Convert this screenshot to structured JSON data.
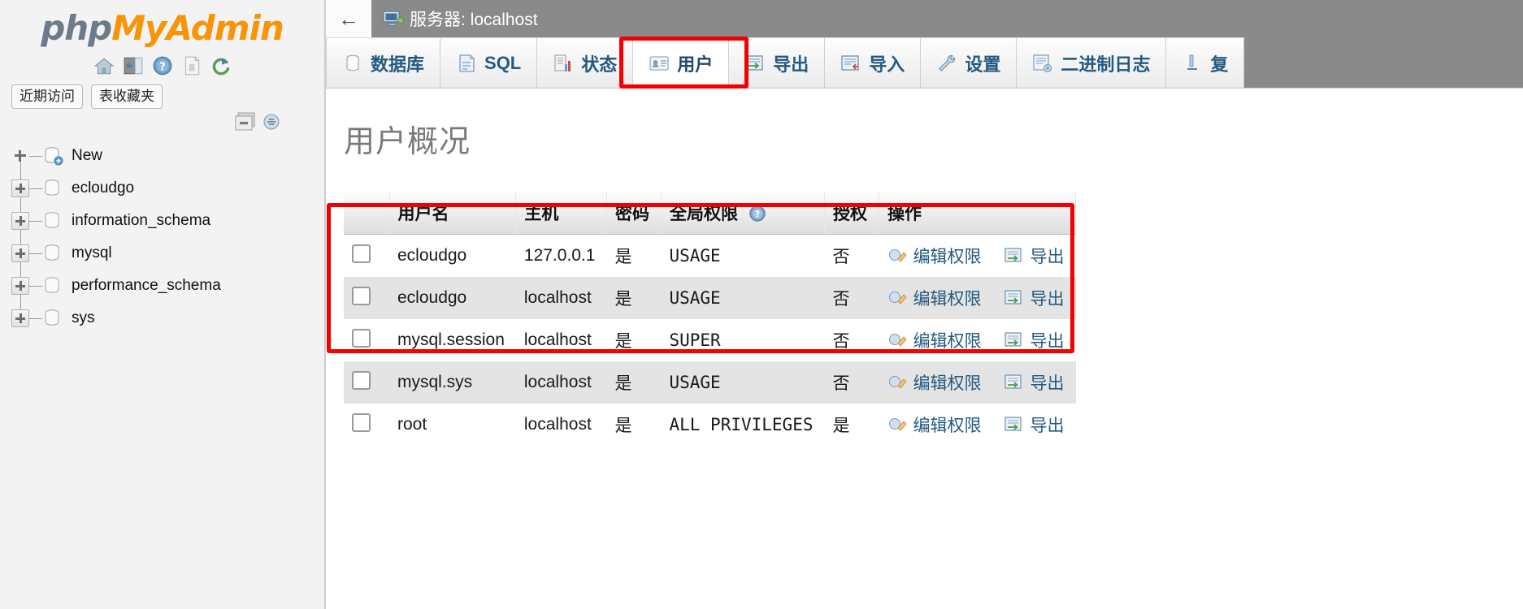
{
  "sidebar": {
    "logo": {
      "php": "php",
      "my": "My",
      "admin": "Admin"
    },
    "logo_icons": [
      {
        "name": "home-icon",
        "label": "主页"
      },
      {
        "name": "logout-icon",
        "label": "退出"
      },
      {
        "name": "help-icon",
        "label": "帮助"
      },
      {
        "name": "docs-icon",
        "label": "文档"
      },
      {
        "name": "reload-icon",
        "label": "重新加载"
      }
    ],
    "quick_buttons": [
      {
        "label": "近期访问"
      },
      {
        "label": "表收藏夹"
      }
    ],
    "panel_controls": [
      {
        "name": "collapse-icon"
      },
      {
        "name": "link-icon"
      }
    ],
    "tree": [
      {
        "label": "New",
        "expandable": false
      },
      {
        "label": "ecloudgo",
        "expandable": true
      },
      {
        "label": "information_schema",
        "expandable": true
      },
      {
        "label": "mysql",
        "expandable": true
      },
      {
        "label": "performance_schema",
        "expandable": true
      },
      {
        "label": "sys",
        "expandable": true
      }
    ]
  },
  "header": {
    "back_label": "←",
    "server_prefix": "服务器: ",
    "server_name": "localhost",
    "server_icon": "server-icon"
  },
  "tabs": [
    {
      "label": "数据库",
      "icon": "database-icon",
      "active": false
    },
    {
      "label": "SQL",
      "icon": "sql-icon",
      "active": false
    },
    {
      "label": "状态",
      "icon": "status-icon",
      "active": false
    },
    {
      "label": "用户",
      "icon": "users-icon",
      "active": true
    },
    {
      "label": "导出",
      "icon": "export-icon",
      "active": false
    },
    {
      "label": "导入",
      "icon": "import-icon",
      "active": false
    },
    {
      "label": "设置",
      "icon": "settings-icon",
      "active": false
    },
    {
      "label": "二进制日志",
      "icon": "binlog-icon",
      "active": false
    },
    {
      "label": "复",
      "icon": "replication-icon",
      "active": false
    }
  ],
  "main": {
    "page_title": "用户概况",
    "table": {
      "columns": [
        "",
        "用户名",
        "主机",
        "密码",
        "全局权限",
        "授权",
        "操作"
      ],
      "global_priv_help_icon": "help-icon",
      "rows": [
        {
          "user": "ecloudgo",
          "host": "127.0.0.1",
          "password": "是",
          "privileges": "USAGE",
          "grant": "否",
          "edit_label": "编辑权限",
          "export_label": "导出"
        },
        {
          "user": "ecloudgo",
          "host": "localhost",
          "password": "是",
          "privileges": "USAGE",
          "grant": "否",
          "edit_label": "编辑权限",
          "export_label": "导出"
        },
        {
          "user": "mysql.session",
          "host": "localhost",
          "password": "是",
          "privileges": "SUPER",
          "grant": "否",
          "edit_label": "编辑权限",
          "export_label": "导出"
        },
        {
          "user": "mysql.sys",
          "host": "localhost",
          "password": "是",
          "privileges": "USAGE",
          "grant": "否",
          "edit_label": "编辑权限",
          "export_label": "导出"
        },
        {
          "user": "root",
          "host": "localhost",
          "password": "是",
          "privileges": "ALL PRIVILEGES",
          "grant": "是",
          "edit_label": "编辑权限",
          "export_label": "导出"
        }
      ]
    }
  },
  "annotations": {
    "accent_red": "#f50000",
    "boxes": [
      {
        "name": "users-tab-highlight"
      },
      {
        "name": "ecloudgo-rows-highlight"
      }
    ]
  }
}
